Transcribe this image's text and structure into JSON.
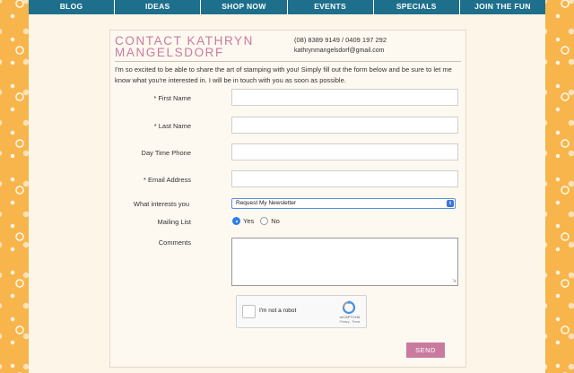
{
  "nav": {
    "items": [
      "BLOG",
      "IDEAS",
      "SHOP NOW",
      "EVENTS",
      "SPECIALS",
      "JOIN THE FUN"
    ]
  },
  "header": {
    "title": "CONTACT KATHRYN MANGELSDORF",
    "phone": "(08) 8389 9149 / 0409 197 292",
    "email": "kathrynmangelsdorf@gmail.com"
  },
  "intro": "I'm so excited to be able to share the art of stamping with you! Simply fill out the form below and be sure to let me know what you're interested in. I will be in touch with you as soon as possible.",
  "form": {
    "first_name_label": "* First Name",
    "last_name_label": "* Last Name",
    "phone_label": "Day Time Phone",
    "email_label": "* Email Address",
    "interests_label": "What interests you",
    "interests_value": "Request My Newsletter",
    "mailing_label": "Mailing List",
    "mailing_yes": "Yes",
    "mailing_no": "No",
    "mailing_selected": "Yes",
    "comments_label": "Comments",
    "send_label": "SEND"
  },
  "captcha": {
    "text": "I'm not a robot",
    "brand": "reCAPTCHA",
    "links": "Privacy - Terms"
  },
  "colors": {
    "nav_bg": "#1d6f8c",
    "accent": "#c97b9f",
    "side_pattern": "#f7b54c"
  }
}
